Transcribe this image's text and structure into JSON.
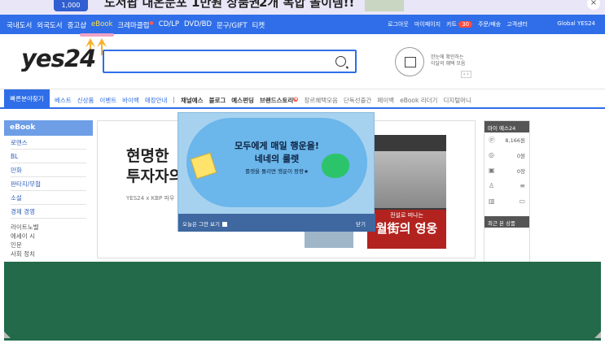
{
  "top_banner": {
    "badge": "1,000",
    "headline": "도서팝 대온문포 1만원 상품권",
    "headline2": "2개 복합 놀이템!!",
    "close": "×"
  },
  "nav": {
    "categories": [
      "국내도서",
      "외국도서",
      "중고샵",
      "eBook",
      "크레마클럽",
      "CD/LP",
      "DVD/BD",
      "문구/GIFT",
      "티켓"
    ],
    "active": "eBook",
    "right_links": [
      "로그아웃",
      "마이페이지",
      "카트",
      "주문/배송",
      "고객센터"
    ],
    "cart_count": "30",
    "global": "Global YES24"
  },
  "logo": "yes24",
  "search": {
    "placeholder": ""
  },
  "promo": {
    "line1": "한눈에 확인하는",
    "line2": "이달의 혜택 모음",
    "pager": "‹ ›"
  },
  "subnav": {
    "quick": "빠른분야찾기",
    "items_blue": [
      "베스트",
      "신상품",
      "이벤트",
      "바이백",
      "매장안내"
    ],
    "items_dark": [
      "채널예스",
      "블로그",
      "예스펀딩",
      "브랜드스토리"
    ],
    "items_gray": [
      "장르혜택모음",
      "단독선출간",
      "페이백",
      "eBook 리더기",
      "디지털머니"
    ]
  },
  "sidebar": {
    "title": "eBook",
    "categories": [
      "로맨스",
      "BL",
      "만화",
      "판타지/무협",
      "소설",
      "경제 경영"
    ],
    "subs": [
      "라이트노벨",
      "에세이 시",
      "인문",
      "사회 정치"
    ]
  },
  "main_banner": {
    "title": "현명한\n투자자의",
    "subtitle": "YES24 x KBP 파우",
    "book_subtitle": "전설로 떠나는",
    "book_title": "월街의 영웅"
  },
  "right_panel": {
    "title": "마이 예스24",
    "rows": [
      {
        "icon": "yes-point-icon",
        "value": "8,166원"
      },
      {
        "icon": "coupon-icon",
        "value": "0원"
      },
      {
        "icon": "gift-card-icon",
        "value": "0장"
      }
    ],
    "recent_title": "최근 본 상품"
  },
  "popup": {
    "line1": "모두에게 매일 행운을!",
    "line2": "네네의 룰렛",
    "line3": "룰렛을 돌리면 행운이 팡팡★",
    "dont_show": "오늘은 그만 보기",
    "close": "닫기"
  }
}
